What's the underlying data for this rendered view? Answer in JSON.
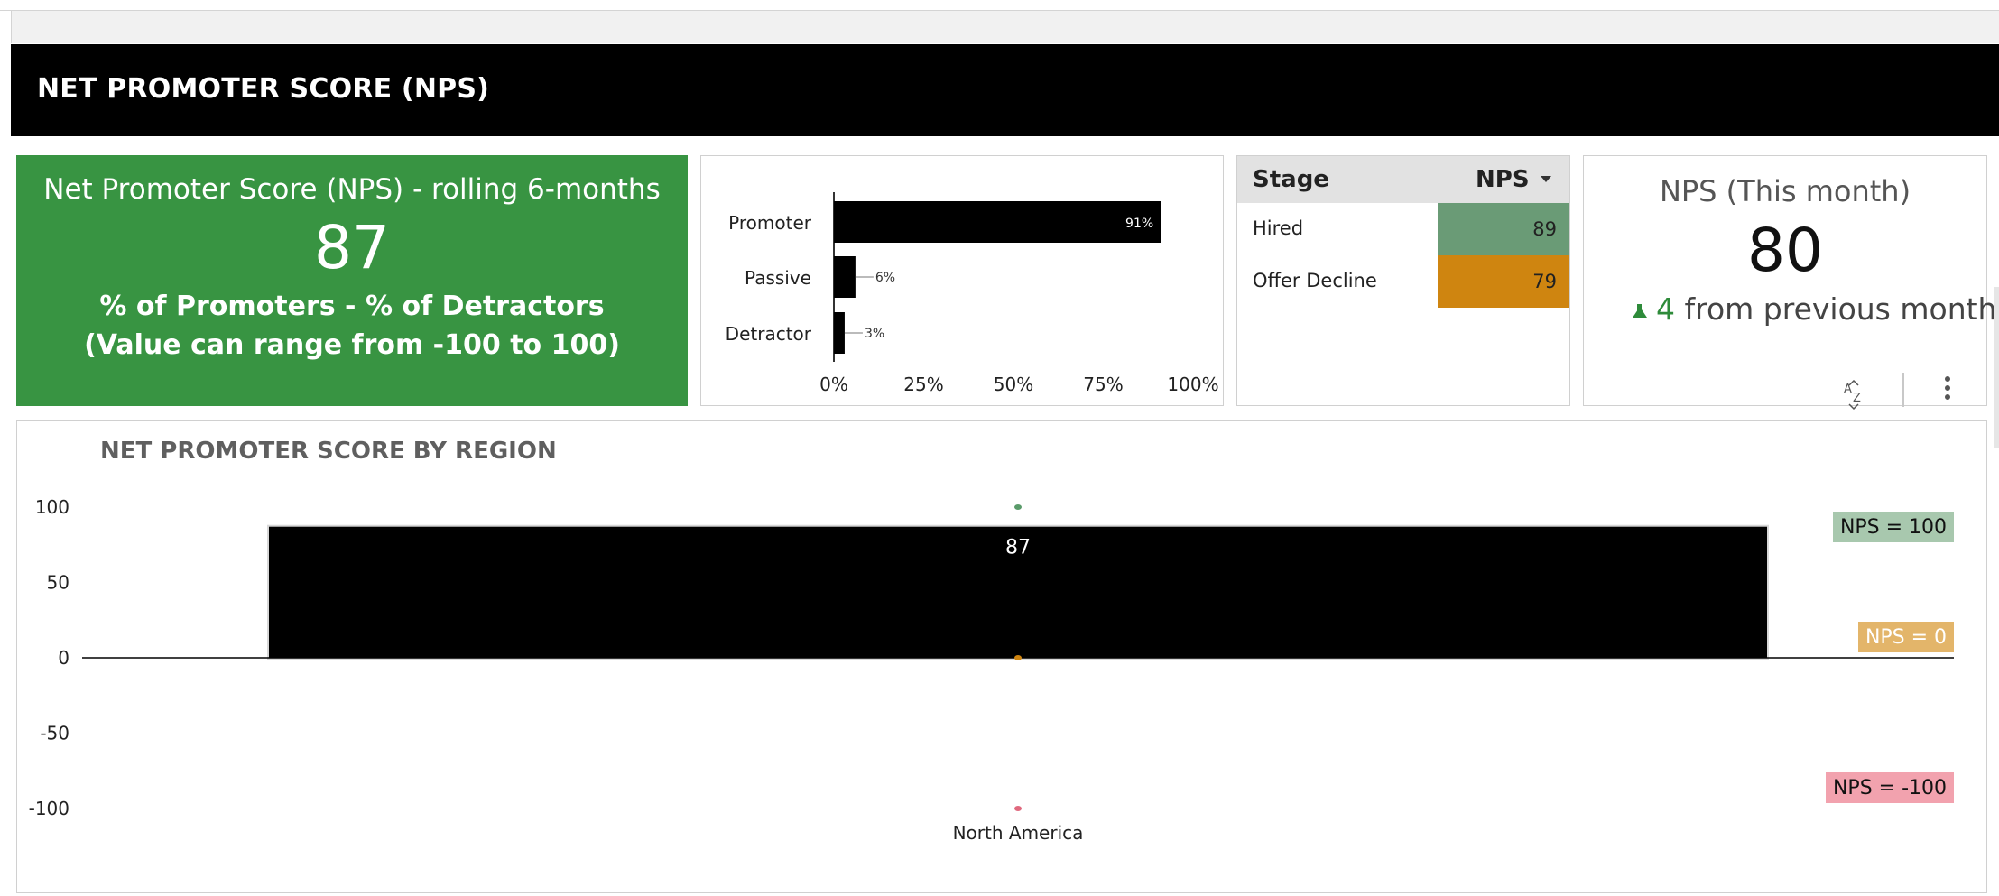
{
  "banner": {
    "title": "NET PROMOTER SCORE (NPS)"
  },
  "nps_rolling": {
    "title": "Net Promoter Score (NPS) - rolling 6-months",
    "value": "87",
    "formula": "% of Promoters - % of Detractors",
    "range_note": "(Value can range from -100 to 100)",
    "background": "#389442"
  },
  "stage_table": {
    "headers": [
      "Stage",
      "NPS"
    ],
    "rows": [
      {
        "stage": "Hired",
        "nps": "89",
        "color": "#6a9b76"
      },
      {
        "stage": "Offer Decline",
        "nps": "79",
        "color": "#cf8510"
      }
    ]
  },
  "nps_month": {
    "title": "NPS (This month)",
    "value": "80",
    "change": "4",
    "change_text": "from previous month",
    "sort_icon": "sort-az-icon",
    "more_icon": "more-vertical-icon"
  },
  "chart_data": [
    {
      "type": "bar",
      "orientation": "horizontal",
      "categories": [
        "Promoter",
        "Passive",
        "Detractor"
      ],
      "values": [
        91,
        6,
        3
      ],
      "value_labels": [
        "91%",
        "6%",
        "3%"
      ],
      "xlim": [
        0,
        100
      ],
      "xticks": [
        "0%",
        "25%",
        "50%",
        "75%",
        "100%"
      ],
      "bar_color": "#000000"
    },
    {
      "type": "bar",
      "title": "NET PROMOTER SCORE BY REGION",
      "categories": [
        "North America"
      ],
      "values": [
        87
      ],
      "value_labels": [
        "87"
      ],
      "ylim": [
        -100,
        100
      ],
      "yticks": [
        "100",
        "50",
        "0",
        "-50",
        "-100"
      ],
      "reference_lines": [
        {
          "label": "NPS = 100",
          "value": 100,
          "color": "#a8c8ae"
        },
        {
          "label": "NPS = 0",
          "value": 0,
          "color": "#e3b56a"
        },
        {
          "label": "NPS = -100",
          "value": -100,
          "color": "#f2a2ae"
        }
      ],
      "bar_color": "#000000"
    }
  ]
}
